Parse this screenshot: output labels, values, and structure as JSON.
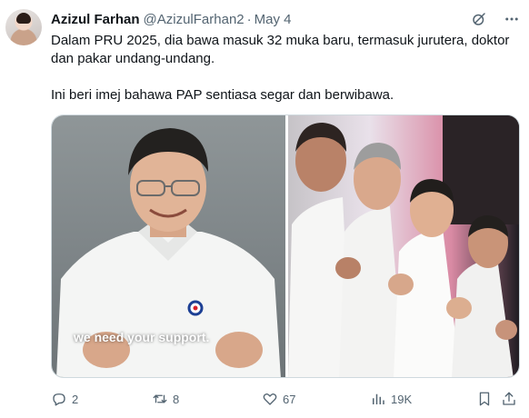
{
  "author": {
    "name": "Azizul Farhan",
    "handle": "@AzizulFarhan2",
    "separator": "·",
    "date": "May 4"
  },
  "tweet": {
    "paragraph1": "Dalam PRU 2025, dia bawa masuk 32 muka baru, termasuk jurutera, doktor dan pakar undang-undang.",
    "paragraph2": "Ini beri imej bahawa PAP sentiasa segar dan berwibawa."
  },
  "media": {
    "caption": "we need your support."
  },
  "actions": {
    "replies": "2",
    "reposts": "8",
    "likes": "67",
    "views": "19K"
  },
  "colors": {
    "text": "#0f1419",
    "secondary": "#536471",
    "border": "#cfd9de"
  },
  "icons": [
    "grok-icon",
    "more-icon",
    "reply-icon",
    "repost-icon",
    "like-icon",
    "views-icon",
    "bookmark-icon",
    "share-icon"
  ]
}
